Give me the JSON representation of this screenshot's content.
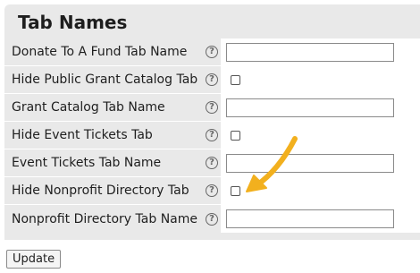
{
  "panel": {
    "title": "Tab Names"
  },
  "rows": [
    {
      "label": "Donate To A Fund Tab Name",
      "control": "text",
      "value": ""
    },
    {
      "label": "Hide Public Grant Catalog Tab",
      "control": "checkbox",
      "checked": false
    },
    {
      "label": "Grant Catalog Tab Name",
      "control": "text",
      "value": ""
    },
    {
      "label": "Hide Event Tickets Tab",
      "control": "checkbox",
      "checked": false
    },
    {
      "label": "Event Tickets Tab Name",
      "control": "text",
      "value": ""
    },
    {
      "label": "Hide Nonprofit Directory Tab",
      "control": "checkbox",
      "checked": false
    },
    {
      "label": "Nonprofit Directory Tab Name",
      "control": "text",
      "value": ""
    }
  ],
  "help_icon": {
    "icon": "question-circle-icon",
    "glyph": "?"
  },
  "update_button": {
    "label": "Update"
  },
  "annotation": {
    "icon": "arrow-icon",
    "color": "#f2b01e"
  },
  "colors": {
    "panel_bg": "#e9e9e9",
    "value_bg": "#ffffff",
    "text": "#1e1e1e"
  }
}
